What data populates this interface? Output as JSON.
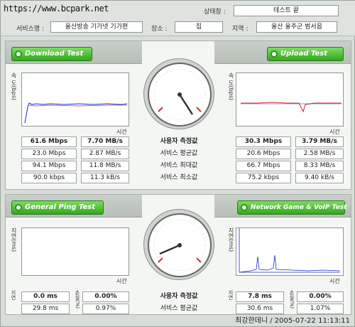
{
  "header": {
    "url": "https://www.bcpark.net",
    "status_label": "상태창 :",
    "status_value": "테스트 끝",
    "service_name_label": "서비스명 :",
    "service_name_value": "울산방송 기가넷 기가편",
    "place_label": "장소 :",
    "place_value": "집",
    "region_label": "지역 :",
    "region_value": "울산 울주군 범서읍"
  },
  "speed": {
    "download_button": "Download Test",
    "upload_button": "Upload Test",
    "y_axis_label": "속 도(bps)",
    "x_axis_label": "시간",
    "rows": [
      {
        "dl_mbps": "61.6 Mbps",
        "dl_mbs": "7.70 MB/s",
        "label": "사용자 측정값",
        "ul_mbps": "30.3 Mbps",
        "ul_mbs": "3.79 MB/s"
      },
      {
        "dl_mbps": "23.0 Mbps",
        "dl_mbs": "2.87 MB/s",
        "label": "서비스 평균값",
        "ul_mbps": "20.6 Mbps",
        "ul_mbs": "2.58 MB/s"
      },
      {
        "dl_mbps": "94.1 Mbps",
        "dl_mbs": "11.8 MB/s",
        "label": "서비스 최대값",
        "ul_mbps": "66.7 Mbps",
        "ul_mbs": "8.33 MB/s"
      },
      {
        "dl_mbps": "90.0 kbps",
        "dl_mbs": "11.3 kB/s",
        "label": "서비스 최소값",
        "ul_mbps": "75.2 kbps",
        "ul_mbs": "9.40 kB/s"
      }
    ]
  },
  "ping": {
    "ping_button": "General Ping Test",
    "game_button": "Network Game & VoIP Test",
    "y_axis_label": "지연(ms)",
    "x_axis_label": "시간",
    "latency_label": "지연",
    "loss_label": "손실(%)",
    "rows": [
      {
        "left_latency": "0.0 ms",
        "left_loss": "0.00%",
        "label": "사용자 측정값",
        "right_latency": "7.8 ms",
        "right_loss": "0.00%"
      },
      {
        "left_latency": "29.8 ms",
        "left_loss": "0.97%",
        "label": "서비스 평균값",
        "right_latency": "30.6 ms",
        "right_loss": "1.07%"
      }
    ]
  },
  "footer": {
    "text": "최강한데니 / 2005-07-22 11:13:11"
  }
}
